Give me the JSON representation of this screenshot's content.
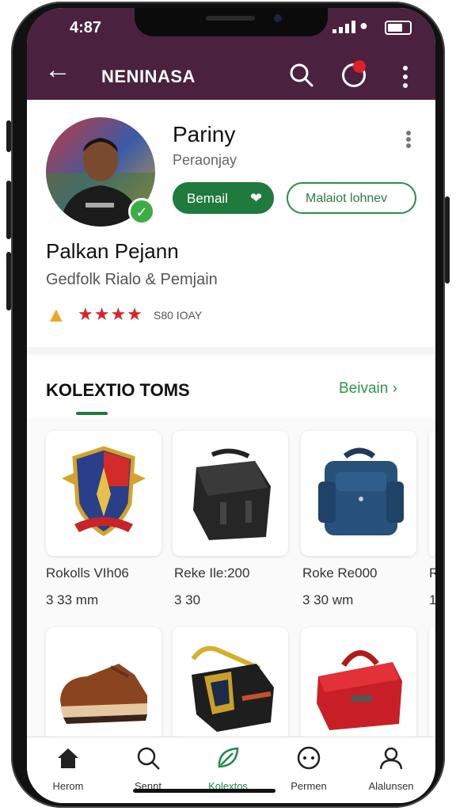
{
  "status": {
    "time": "4:87"
  },
  "appbar": {
    "title": "NENINASA"
  },
  "profile": {
    "name": "Pariny",
    "subtitle": "Peraonjay",
    "follow_label": "Bemail",
    "message_label": "Malaiot lohnev",
    "full_name": "Palkan Pejann",
    "bio": "Gedfolk Rialo & Pemjain",
    "rating_stars": 4,
    "rating_text": "S80 IOAY",
    "colors": {
      "primary": "#1f7a3e",
      "bar": "#4a2240",
      "star": "#d8232a"
    }
  },
  "collection": {
    "title": "KOLEXTIO TOMS",
    "view_all": "Beivain",
    "items": [
      {
        "name": "Rokolls VIh06",
        "price": "3 33 mm",
        "icon": "crest-icon"
      },
      {
        "name": "Reke Ile:200",
        "price": "3 30",
        "icon": "black-bag-icon"
      },
      {
        "name": "Roke Re000",
        "price": "3 30 wm",
        "icon": "blue-backpack-icon"
      },
      {
        "name": "R",
        "price": "1",
        "icon": "crest-icon"
      }
    ],
    "row2_icons": [
      "shoe-icon",
      "black-gear-bag-icon",
      "red-bag-icon"
    ]
  },
  "nav": [
    {
      "label": "Herom",
      "icon": "home-icon"
    },
    {
      "label": "Sennt",
      "icon": "search-icon"
    },
    {
      "label": "Kolextos",
      "icon": "leaf-icon"
    },
    {
      "label": "Permen",
      "icon": "chat-icon"
    },
    {
      "label": "Alalunsen",
      "icon": "profile-icon"
    }
  ]
}
